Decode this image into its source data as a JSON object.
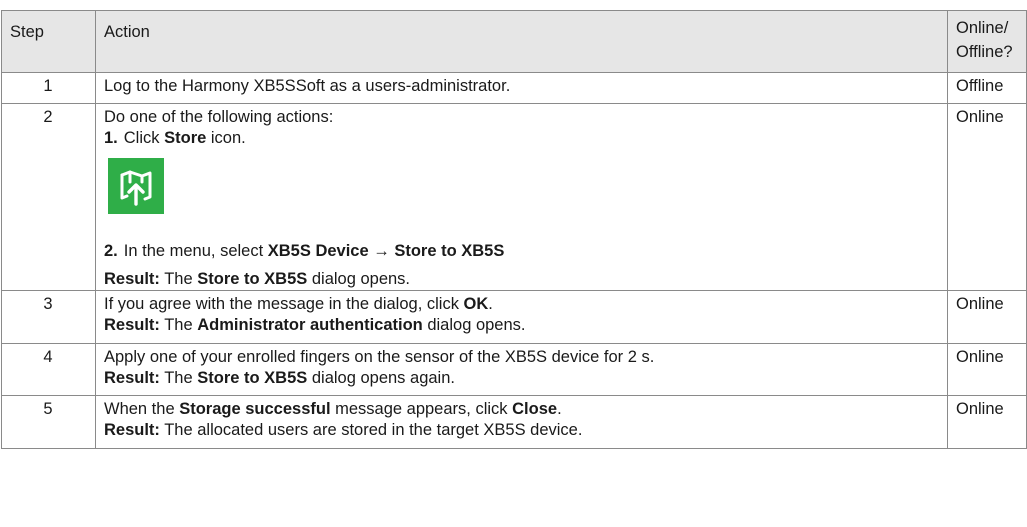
{
  "header": {
    "step": "Step",
    "action": "Action",
    "online_line1": "Online/",
    "online_line2": "Offline?"
  },
  "rows": [
    {
      "step": "1",
      "text": "Log to the Harmony XB5SSoft as a users-administrator.",
      "mode": "Offline"
    },
    {
      "step": "2",
      "intro": "Do one of the following actions:",
      "item1_num": "1.",
      "item1_pre": "Click ",
      "item1_bold": "Store",
      "item1_post": " icon.",
      "icon": "store-icon",
      "icon_color": "#2fae48",
      "item2_num": "2.",
      "item2_pre": "In the menu, select ",
      "item2_bold1": "XB5S Device",
      "item2_arrow": " → ",
      "item2_bold2": "Store to XB5S",
      "result_label": "Result:",
      "result_pre": " The ",
      "result_bold": "Store to XB5S",
      "result_post": " dialog opens.",
      "mode": "Online"
    },
    {
      "step": "3",
      "text_pre": "If you agree with the message in the dialog, click ",
      "text_bold": "OK",
      "text_post": ".",
      "result_label": "Result:",
      "result_pre": " The ",
      "result_bold": "Administrator authentication",
      "result_post": " dialog opens.",
      "mode": "Online"
    },
    {
      "step": "4",
      "text": "Apply one of your enrolled fingers on the sensor of the XB5S device for 2 s.",
      "result_label": "Result:",
      "result_pre": " The ",
      "result_bold": "Store to XB5S",
      "result_post": " dialog opens again.",
      "mode": "Online"
    },
    {
      "step": "5",
      "text_pre": "When the ",
      "text_bold1": "Storage successful",
      "text_mid": " message appears, click ",
      "text_bold2": "Close",
      "text_post": ".",
      "result_label": "Result:",
      "result_text": " The allocated users are stored in the target XB5S device.",
      "mode": "Online"
    }
  ]
}
